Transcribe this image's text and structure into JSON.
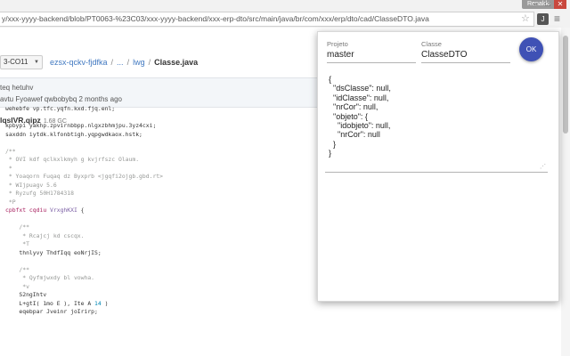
{
  "browser": {
    "profile": "Renaldo",
    "url": "y/xxx-yyyy-backend/blob/PT0063-%23C03/xxx-yyyy-backend/xxx-erp-dto/src/main/java/br/com/xxx/erp/dto/cad/ClasseDTO.java",
    "win_minimize": "–",
    "win_maximize": "□",
    "win_close": "✕",
    "star_glyph": "☆",
    "ext_glyph": "J",
    "menu_glyph": "≡"
  },
  "repo": {
    "branch": "3-CO11",
    "branch_caret": "▼",
    "breadcrumb": [
      {
        "label": "ezsx-qckv-fjdfka"
      },
      {
        "label": "..."
      },
      {
        "label": "lwg"
      },
      {
        "label": "Classe.java"
      }
    ],
    "separator": "/",
    "commit_message": "teq hetuhv",
    "commit_meta": "avtu Fyoawef qwbobybq 2 months ago",
    "file_name": "lqslVR.qipz",
    "file_size": "1.68 GC"
  },
  "code_lines": [
    [
      {
        "t": "wehebfe vp.tfc.yqfn.kxd.fjq.enl;",
        "c": ""
      }
    ],
    [
      {
        "t": "",
        "c": ""
      }
    ],
    [
      {
        "t": "kpbypi yakhp.zpvirnbbpp.nlgxzbhmjpu.3yz4cxi;",
        "c": ""
      }
    ],
    [
      {
        "t": "saxddn iytdk.klfonbtigh.yqpgwdkaox.hstk;",
        "c": ""
      }
    ],
    [
      {
        "t": "",
        "c": ""
      }
    ],
    [
      {
        "t": "/**",
        "c": "c-com"
      }
    ],
    [
      {
        "t": " * OVI kdf qclkxlkmyh g kvjrfszc Olaum.",
        "c": "c-com"
      }
    ],
    [
      {
        "t": " *",
        "c": "c-com"
      }
    ],
    [
      {
        "t": " * Yoaqorn Fuqaq dz Byxprb <jgqfi2ojgb.gbd.rt>",
        "c": "c-com"
      }
    ],
    [
      {
        "t": " * WIjpuagv 5.6",
        "c": "c-com"
      }
    ],
    [
      {
        "t": " * Ryzufg 50H1784318",
        "c": "c-com"
      }
    ],
    [
      {
        "t": " *P",
        "c": "c-com"
      }
    ],
    [
      {
        "t": "cpbfxt cqdiu ",
        "c": "c-kw"
      },
      {
        "t": "VrxghKXI",
        "c": "c-ent"
      },
      {
        "t": " {",
        "c": ""
      }
    ],
    [
      {
        "t": "",
        "c": ""
      }
    ],
    [
      {
        "t": "    /**",
        "c": "c-com"
      }
    ],
    [
      {
        "t": "     * Rcajcj kd cscqx.",
        "c": "c-com"
      }
    ],
    [
      {
        "t": "     *T",
        "c": "c-com"
      }
    ],
    [
      {
        "t": "    thnlyvy ThdfIqq eoNrjIS;",
        "c": ""
      }
    ],
    [
      {
        "t": "",
        "c": ""
      }
    ],
    [
      {
        "t": "    /**",
        "c": "c-com"
      }
    ],
    [
      {
        "t": "     * Qyfmjwxdy bl vowha.",
        "c": "c-com"
      }
    ],
    [
      {
        "t": "     *v",
        "c": "c-com"
      }
    ],
    [
      {
        "t": "    S2ngIhtv",
        "c": ""
      }
    ],
    [
      {
        "t": "    L+gtI( 1mo E ), Ite A ",
        "c": ""
      },
      {
        "t": "14",
        "c": "c-num"
      },
      {
        "t": " )",
        "c": ""
      }
    ],
    [
      {
        "t": "    eqebpar Jveinr joIrirp;",
        "c": ""
      }
    ]
  ],
  "popup": {
    "projeto_label": "Projeto",
    "projeto_value": "master",
    "classe_label": "Classe",
    "classe_value": "ClasseDTO",
    "ok_label": "OK",
    "resize_glyph": "⋰",
    "json_lines": [
      "{",
      "  \"dsClasse\": null,",
      "  \"idClasse\": null,",
      "  \"nrCor\": null,",
      "  \"objeto\": {",
      "    \"idobjeto\": null,",
      "    \"nrCor\": null",
      "  }",
      "}"
    ]
  }
}
